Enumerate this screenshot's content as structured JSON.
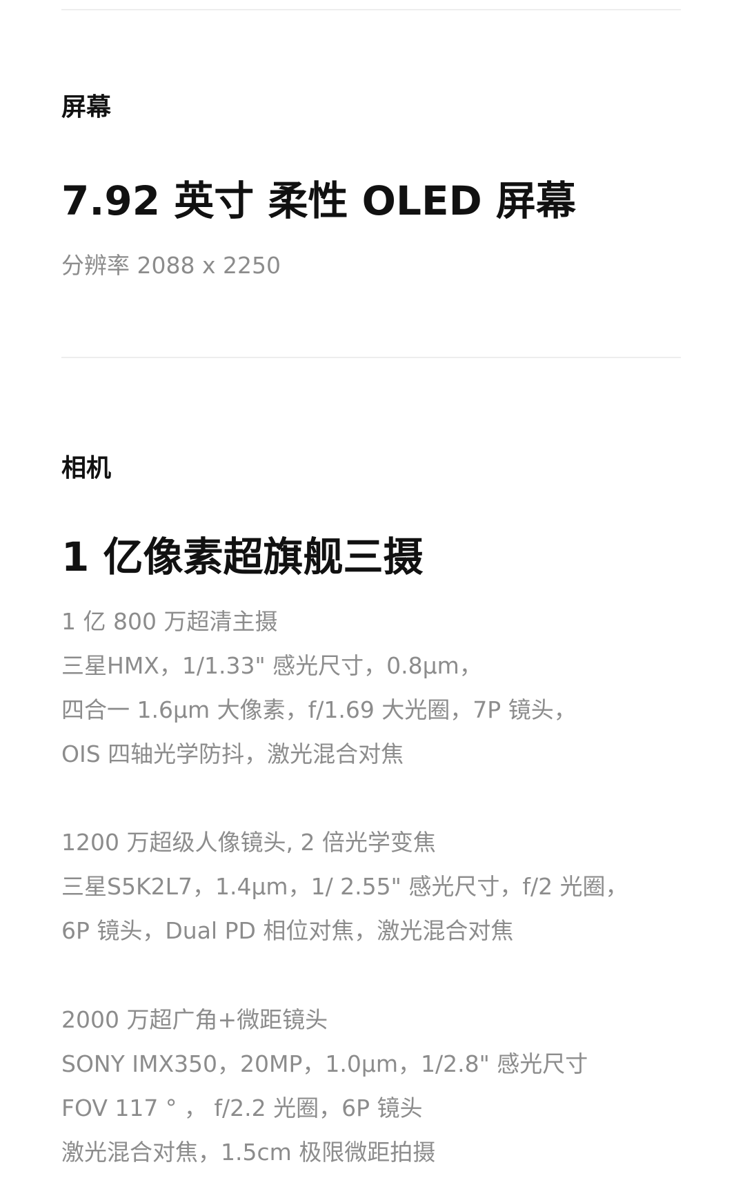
{
  "display": {
    "section_label": "屏幕",
    "headline": "7.92 英寸 柔性 OLED 屏幕",
    "resolution": "分辨率 2088 x 2250"
  },
  "camera": {
    "section_label": "相机",
    "headline": "1 亿像素超旗舰三摄",
    "main_lens": [
      "1 亿 800 万超清主摄",
      "三星HMX，1/1.33\" 感光尺寸，0.8μm，",
      "四合一 1.6μm 大像素，f/1.69 大光圈，7P 镜头，",
      "OIS 四轴光学防抖，激光混合对焦"
    ],
    "portrait_lens": [
      "1200 万超级人像镜头, 2 倍光学变焦",
      "三星S5K2L7，1.4μm，1/ 2.55\" 感光尺寸，f/2 光圈，",
      "6P 镜头，Dual PD 相位对焦，激光混合对焦"
    ],
    "wide_macro_lens": [
      "2000 万超广角+微距镜头",
      "SONY IMX350，20MP，1.0μm，1/2.8\" 感光尺寸",
      "FOV 117 ° ， f/2.2 光圈，6P 镜头",
      "激光混合对焦，1.5cm 极限微距拍摄"
    ]
  }
}
